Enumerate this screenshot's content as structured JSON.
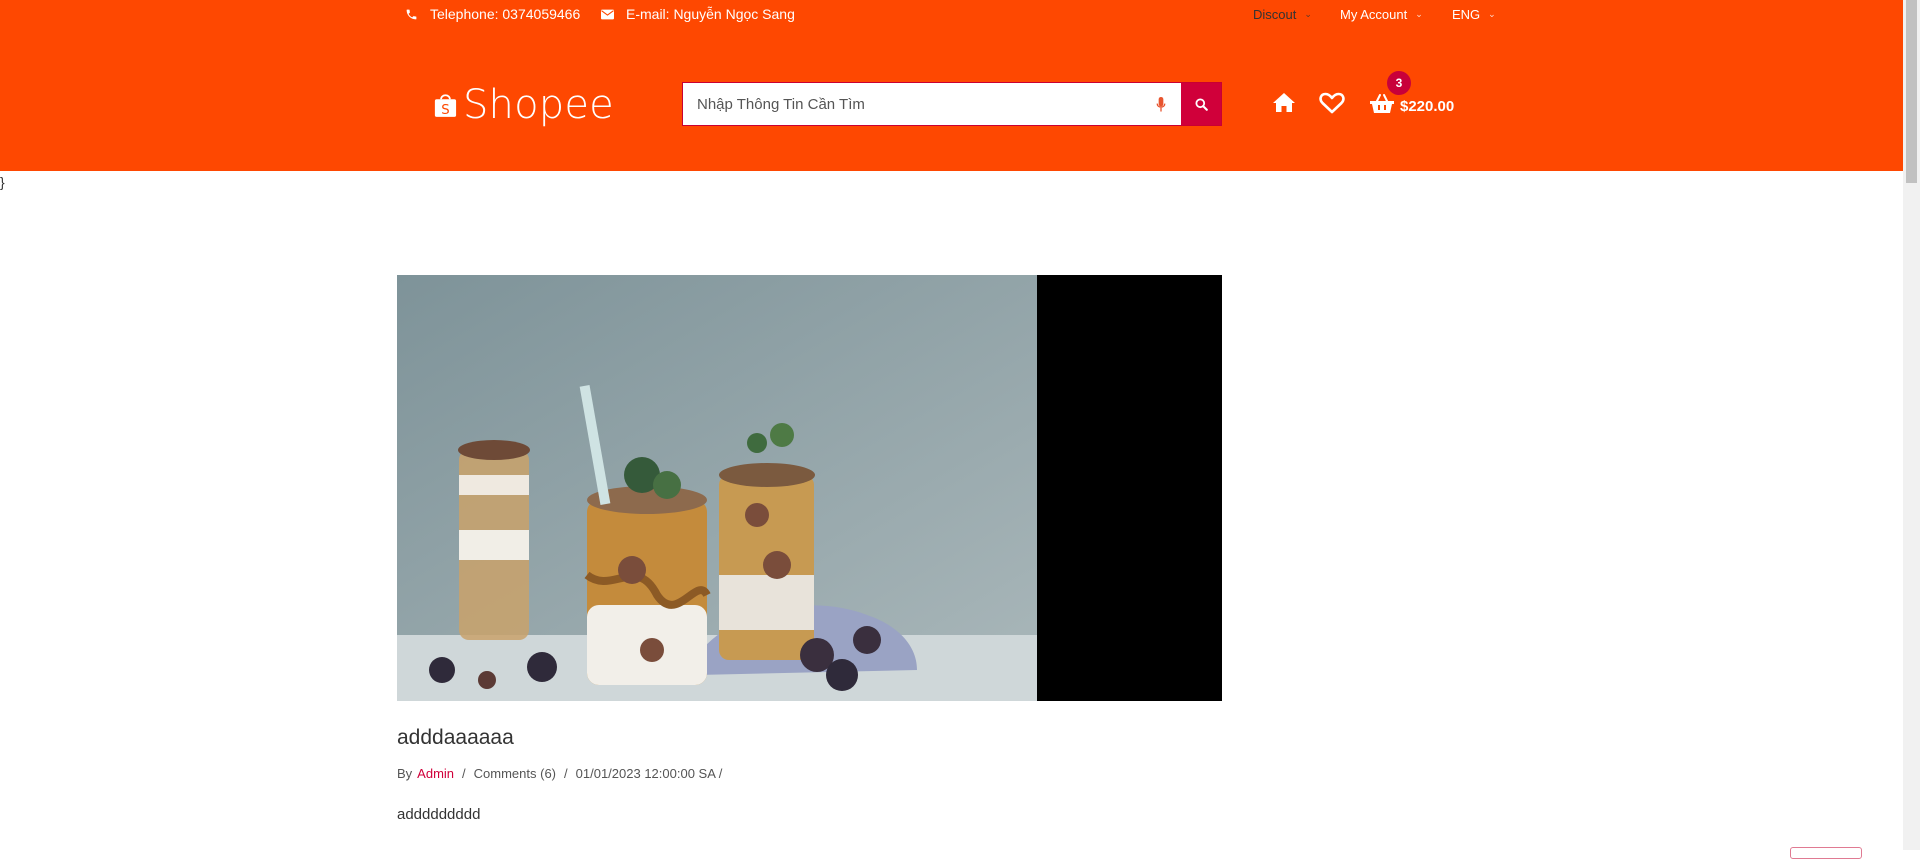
{
  "topbar": {
    "telephone": "Telephone: 0374059466",
    "email": "E-mail: Nguyễn Ngọc Sang",
    "discount": "Discout",
    "account": "My Account",
    "language": "ENG"
  },
  "logo": {
    "text": "Shopee",
    "letter": "S"
  },
  "search": {
    "placeholder": "Nhập Thông Tin Cần Tìm"
  },
  "cart": {
    "count": "3",
    "total": "$220.00"
  },
  "stray_text": "}",
  "post": {
    "title": "adddaaaaaa",
    "by": "By",
    "author": "Admin",
    "comments": "Comments (6)",
    "date": "01/01/2023 12:00:00 SA /",
    "body": "addddddddd"
  },
  "colors": {
    "header": "#fe4801",
    "accent": "#d0003a"
  },
  "icons": [
    "phone-icon",
    "envelope-icon",
    "microphone-icon",
    "search-icon",
    "home-icon",
    "heart-icon",
    "basket-icon"
  ]
}
